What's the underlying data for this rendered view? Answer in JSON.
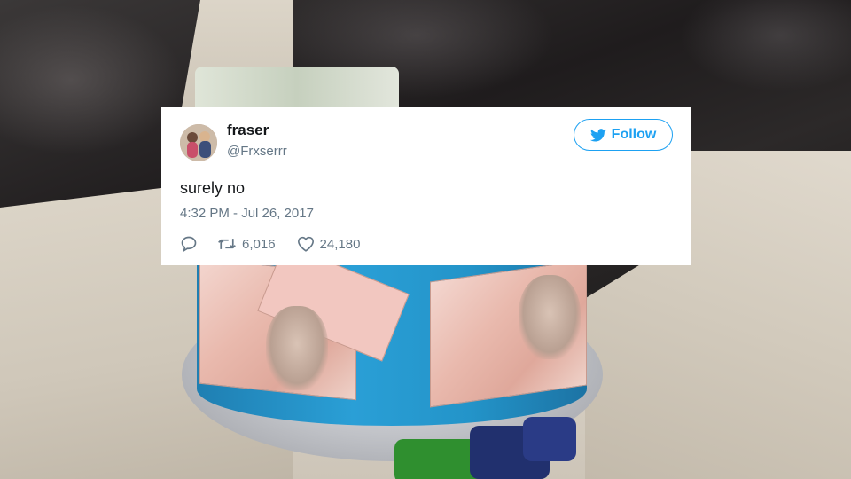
{
  "tweet": {
    "author_name": "fraser",
    "author_handle": "@Frxserrr",
    "follow_label": "Follow",
    "text": "surely no",
    "timestamp": "4:32 PM - Jul 26, 2017",
    "retweet_count": "6,016",
    "like_count": "24,180"
  },
  "icons": {
    "reply": "reply-icon",
    "retweet": "retweet-icon",
    "like": "heart-icon",
    "follow": "twitter-bird-icon"
  },
  "colors": {
    "accent": "#1da1f2",
    "text": "#14171a",
    "muted": "#657786",
    "card": "#ffffff"
  }
}
